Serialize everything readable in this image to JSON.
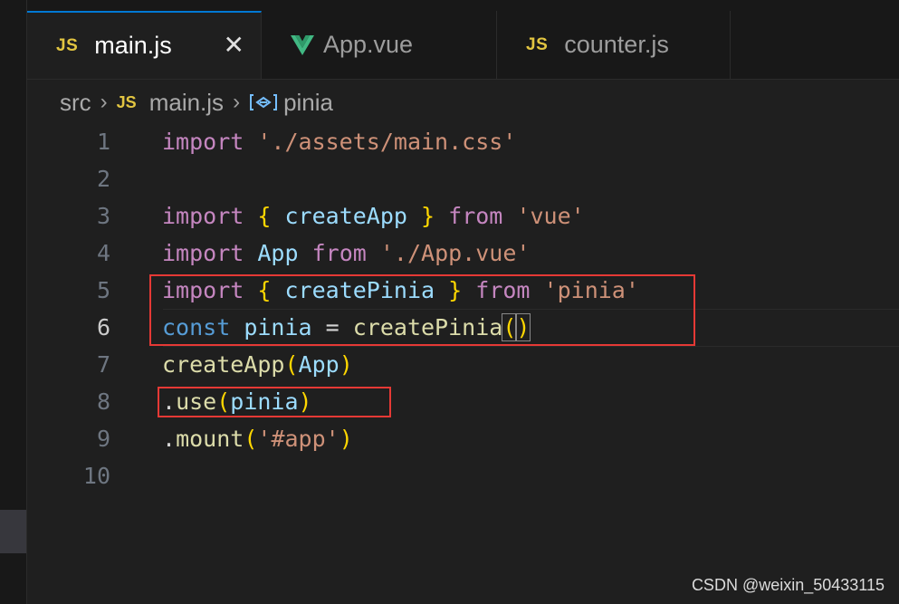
{
  "tabs": [
    {
      "badge": "JS",
      "label": "main.js",
      "active": true,
      "close": "✕"
    },
    {
      "badge": "",
      "label": "App.vue",
      "active": false,
      "icon": "vue-icon"
    },
    {
      "badge": "JS",
      "label": "counter.js",
      "active": false
    }
  ],
  "breadcrumb": {
    "folder": "src",
    "file_badge": "JS",
    "file": "main.js",
    "symbol": "pinia"
  },
  "editor": {
    "current_line": 6,
    "lines": [
      {
        "n": "1",
        "tokens": [
          [
            "kw",
            "import"
          ],
          [
            "plain",
            " "
          ],
          [
            "str",
            "'./assets/main.css'"
          ]
        ]
      },
      {
        "n": "2",
        "tokens": []
      },
      {
        "n": "3",
        "tokens": [
          [
            "kw",
            "import"
          ],
          [
            "plain",
            " "
          ],
          [
            "brace",
            "{"
          ],
          [
            "plain",
            " "
          ],
          [
            "var",
            "createApp"
          ],
          [
            "plain",
            " "
          ],
          [
            "brace",
            "}"
          ],
          [
            "plain",
            " "
          ],
          [
            "kw",
            "from"
          ],
          [
            "plain",
            " "
          ],
          [
            "str",
            "'vue'"
          ]
        ]
      },
      {
        "n": "4",
        "tokens": [
          [
            "kw",
            "import"
          ],
          [
            "plain",
            " "
          ],
          [
            "var",
            "App"
          ],
          [
            "plain",
            " "
          ],
          [
            "kw",
            "from"
          ],
          [
            "plain",
            " "
          ],
          [
            "str",
            "'./App.vue'"
          ]
        ]
      },
      {
        "n": "5",
        "tokens": [
          [
            "kw",
            "import"
          ],
          [
            "plain",
            " "
          ],
          [
            "brace",
            "{"
          ],
          [
            "plain",
            " "
          ],
          [
            "var",
            "createPinia"
          ],
          [
            "plain",
            " "
          ],
          [
            "brace",
            "}"
          ],
          [
            "plain",
            " "
          ],
          [
            "kw",
            "from"
          ],
          [
            "plain",
            " "
          ],
          [
            "str",
            "'pinia'"
          ]
        ]
      },
      {
        "n": "6",
        "tokens": [
          [
            "kw2",
            "const"
          ],
          [
            "plain",
            " "
          ],
          [
            "var",
            "pinia"
          ],
          [
            "plain",
            " = "
          ],
          [
            "fn",
            "createPinia"
          ],
          [
            "braceb",
            "("
          ],
          [
            "braceb",
            ")"
          ]
        ]
      },
      {
        "n": "7",
        "tokens": [
          [
            "fn",
            "createApp"
          ],
          [
            "brace",
            "("
          ],
          [
            "var",
            "App"
          ],
          [
            "brace",
            ")"
          ]
        ]
      },
      {
        "n": "8",
        "tokens": [
          [
            "plain",
            "."
          ],
          [
            "fn",
            "use"
          ],
          [
            "brace",
            "("
          ],
          [
            "var",
            "pinia"
          ],
          [
            "brace",
            ")"
          ]
        ]
      },
      {
        "n": "9",
        "tokens": [
          [
            "plain",
            "."
          ],
          [
            "fn",
            "mount"
          ],
          [
            "brace",
            "("
          ],
          [
            "str",
            "'#app'"
          ],
          [
            "brace",
            ")"
          ]
        ]
      },
      {
        "n": "10",
        "tokens": []
      }
    ]
  },
  "colors": {
    "keyword": "#c586c0",
    "storage": "#569cd6",
    "string": "#ce9178",
    "function": "#dcdcaa",
    "variable": "#9cdcfe",
    "bracket": "#ffd700",
    "annotation_box": "#e53935"
  },
  "watermark": "CSDN @weixin_50433115"
}
